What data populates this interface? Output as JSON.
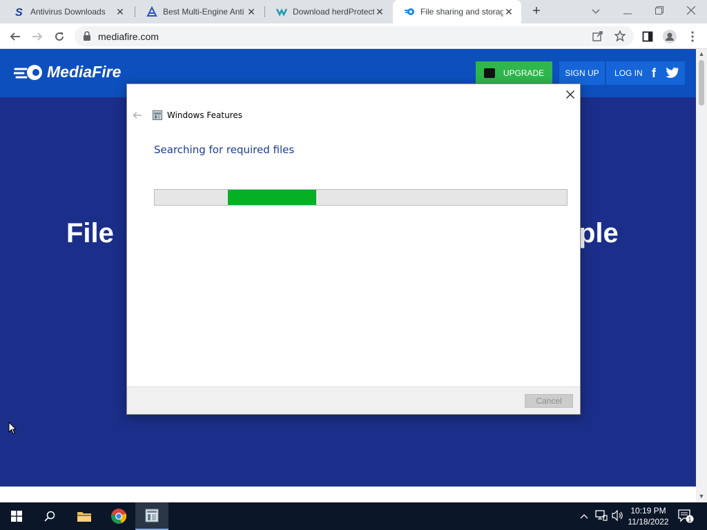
{
  "tabs": [
    {
      "title": "Antivirus Downloads",
      "favicon": "softpedia-s-icon",
      "active": false
    },
    {
      "title": "Best Multi-Engine Anti",
      "favicon": "multi-engine-icon",
      "active": false
    },
    {
      "title": "Download herdProtect",
      "favicon": "herdprotect-icon",
      "active": false
    },
    {
      "title": "File sharing and storag",
      "favicon": "mediafire-icon",
      "active": true
    }
  ],
  "tab_close_glyph": "✕",
  "new_tab_glyph": "+",
  "address": {
    "url": "mediafire.com"
  },
  "site": {
    "logo_text": "MediaFire",
    "upgrade_label": "UPGRADE",
    "signup_label": "SIGN UP",
    "login_label": "LOG IN",
    "facebook_glyph": "f",
    "hero_left": "File",
    "hero_right": "ple",
    "colors": {
      "header": "#0d4fbd",
      "upgrade": "#2fb64c",
      "hero_bg": "#1b2f8a"
    }
  },
  "dialog": {
    "app_title": "Windows Features",
    "heading": "Searching for required files",
    "cancel_label": "Cancel",
    "progress": {
      "start_fraction": 0.178,
      "end_fraction": 0.392,
      "indeterminate": true,
      "color": "#06b025"
    }
  },
  "taskbar": {
    "time": "10:19 PM",
    "date": "11/18/2022",
    "notification_count": "1"
  }
}
